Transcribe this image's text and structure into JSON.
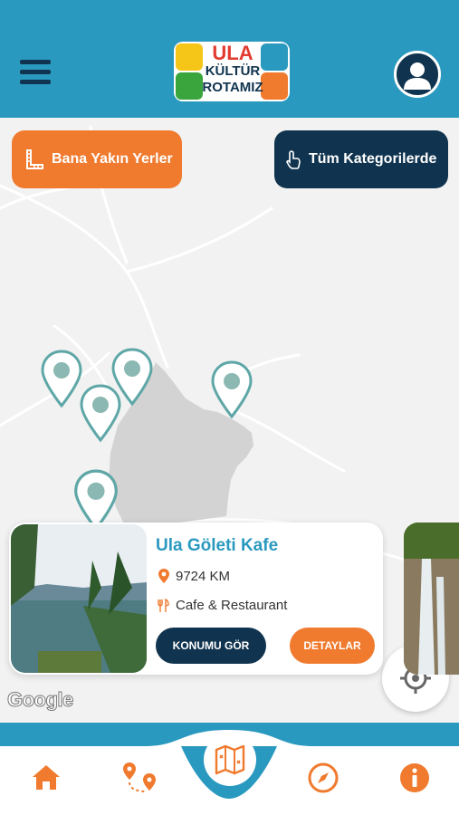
{
  "header": {
    "logo_line1": "ULA",
    "logo_line2": "KÜLTÜR",
    "logo_line3": "ROTAMIZ"
  },
  "filters": {
    "near_label": "Bana Yakın Yerler",
    "category_label": "Tüm Kategorilerde"
  },
  "card": {
    "title": "Ula Göleti Kafe",
    "distance": "9724 KM",
    "category": "Cafe & Restaurant",
    "location_button": "KONUMU GÖR",
    "details_button": "DETAYLAR"
  },
  "map": {
    "attribution": "Google"
  },
  "colors": {
    "primary": "#2a99bf",
    "navy": "#10344f",
    "accent": "#f07a2e"
  },
  "nav": {
    "items": [
      "home-icon",
      "route-icon",
      "map-icon",
      "compass-icon",
      "info-icon"
    ]
  }
}
